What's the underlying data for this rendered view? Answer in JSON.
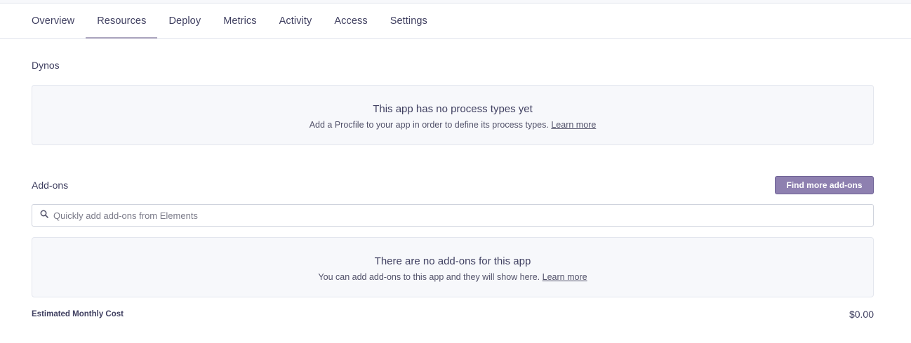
{
  "nav": {
    "tabs": [
      {
        "label": "Overview"
      },
      {
        "label": "Resources",
        "active": true
      },
      {
        "label": "Deploy"
      },
      {
        "label": "Metrics"
      },
      {
        "label": "Activity"
      },
      {
        "label": "Access"
      },
      {
        "label": "Settings"
      }
    ]
  },
  "dynos": {
    "title": "Dynos",
    "empty_title": "This app has no process types yet",
    "empty_desc": "Add a Procfile to your app in order to define its process types.",
    "learn_more": "Learn more"
  },
  "addons": {
    "title": "Add-ons",
    "find_button": "Find more add-ons",
    "search_placeholder": "Quickly add add-ons from Elements",
    "search_value": "",
    "empty_title": "There are no add-ons for this app",
    "empty_desc": "You can add add-ons to this app and they will show here.",
    "learn_more": "Learn more"
  },
  "cost": {
    "label": "Estimated Monthly Cost",
    "value": "$0.00"
  },
  "colors": {
    "accent": "#8e80b0",
    "tab_underline": "#a9a3bd",
    "panel_bg": "#f7f8fb",
    "border": "#e3e6ee"
  },
  "icons": {
    "search": "search-icon"
  }
}
